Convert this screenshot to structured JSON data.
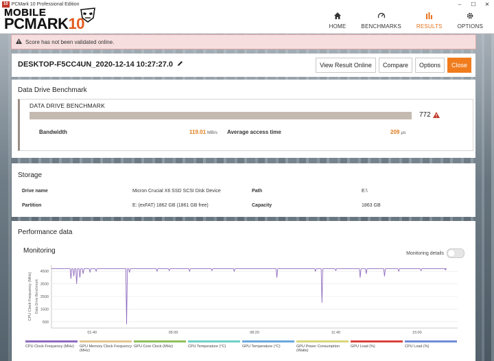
{
  "window": {
    "badge": "10",
    "title": "PCMark 10 Professional Edition"
  },
  "logo": {
    "line1": "MOBILE",
    "line2_main": "PCMARK",
    "line2_num": "10"
  },
  "nav": [
    {
      "id": "home",
      "label": "HOME",
      "icon": "home-icon",
      "active": false
    },
    {
      "id": "benchmarks",
      "label": "BENCHMARKS",
      "icon": "gauge-icon",
      "active": false
    },
    {
      "id": "results",
      "label": "RESULTS",
      "icon": "bar-chart-icon",
      "active": true
    },
    {
      "id": "options",
      "label": "OPTIONS",
      "icon": "gear-icon",
      "active": false
    }
  ],
  "warning": {
    "text": "Score has not been validated online."
  },
  "result": {
    "name": "DESKTOP-F5CC4UN_2020-12-14 10:27:27.0",
    "buttons": {
      "view_online": "View Result Online",
      "compare": "Compare",
      "options": "Options",
      "close": "Close"
    }
  },
  "benchmark": {
    "section_title": "Data Drive Benchmark",
    "name": "DATA DRIVE BENCHMARK",
    "score": "772",
    "bandwidth_label": "Bandwidth",
    "bandwidth_value": "119.01",
    "bandwidth_unit": "MB/s",
    "access_label": "Average access time",
    "access_value": "209",
    "access_unit": "μs"
  },
  "storage": {
    "section_title": "Storage",
    "drive_name_label": "Drive name",
    "drive_name_value": "Micron Crucial X6 SSD SCSI Disk Device",
    "path_label": "Path",
    "path_value": "E:\\",
    "partition_label": "Partition",
    "partition_value": "E: (exFAT) 1862 GB (1861 GB free)",
    "capacity_label": "Capacity",
    "capacity_value": "1863 GB"
  },
  "performance": {
    "section_title": "Performance data",
    "monitoring_title": "Monitoring",
    "monitoring_details_label": "Monitoring details"
  },
  "chart_data": {
    "type": "line",
    "ylabel": "CPU Clock Frequency (MHz)",
    "annotation": "Data Drive Benchmark",
    "y_ticks": [
      500,
      1500,
      2500,
      3500,
      4500
    ],
    "ylim": [
      0,
      5000
    ],
    "x_ticks": [
      "01:40",
      "05:00",
      "08:20",
      "11:40",
      "15:00"
    ],
    "x_tick_seconds": [
      100,
      300,
      500,
      700,
      900
    ],
    "xlim_seconds": [
      0,
      1000
    ],
    "grid": true,
    "series_color": "#8e6bbf",
    "baseline": 4700,
    "dips": [
      {
        "t": 48,
        "v": 3900
      },
      {
        "t": 55,
        "v": 4100
      },
      {
        "t": 62,
        "v": 3500
      },
      {
        "t": 70,
        "v": 4000
      },
      {
        "t": 78,
        "v": 4300
      },
      {
        "t": 95,
        "v": 4400
      },
      {
        "t": 110,
        "v": 4500
      },
      {
        "t": 185,
        "v": 300
      },
      {
        "t": 192,
        "v": 4400
      },
      {
        "t": 260,
        "v": 4500
      },
      {
        "t": 290,
        "v": 4550
      },
      {
        "t": 340,
        "v": 4500
      },
      {
        "t": 395,
        "v": 4550
      },
      {
        "t": 450,
        "v": 4500
      },
      {
        "t": 555,
        "v": 4000
      },
      {
        "t": 650,
        "v": 4500
      },
      {
        "t": 666,
        "v": 2000
      },
      {
        "t": 700,
        "v": 4550
      },
      {
        "t": 760,
        "v": 4000
      },
      {
        "t": 775,
        "v": 4300
      },
      {
        "t": 820,
        "v": 4100
      },
      {
        "t": 855,
        "v": 4500
      },
      {
        "t": 910,
        "v": 4550
      },
      {
        "t": 970,
        "v": 4600
      }
    ],
    "legend": [
      {
        "name": "CPU Clock Frequency (MHz)",
        "color": "#8e6bbf"
      },
      {
        "name": "GPU Memory Clock Frequency (MHz)",
        "color": "#e2c58e"
      },
      {
        "name": "GPU Core Clock (MHz)",
        "color": "#8fbf5e"
      },
      {
        "name": "CPU Temperature (°C)",
        "color": "#6fd0c6"
      },
      {
        "name": "GPU Temperature (°C)",
        "color": "#69a8de"
      },
      {
        "name": "GPU Power Consumption (Watts)",
        "color": "#d9d77a"
      },
      {
        "name": "GPU Load (%)",
        "color": "#d8423c"
      },
      {
        "name": "CPU Load (%)",
        "color": "#6f8bd8"
      }
    ]
  }
}
